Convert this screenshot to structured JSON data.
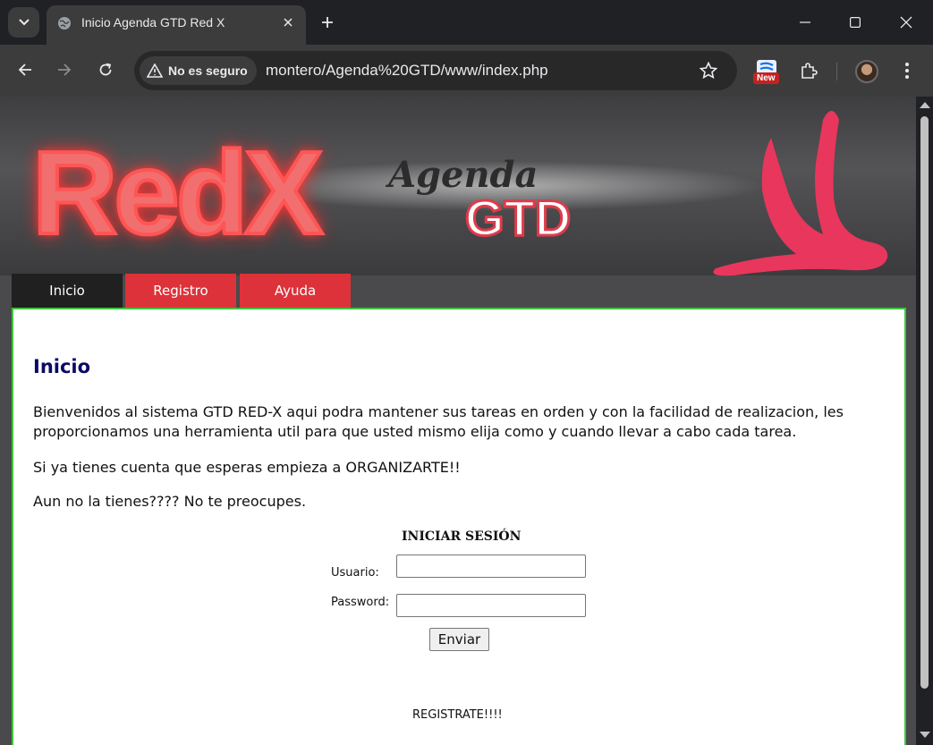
{
  "browser": {
    "tab_title": "Inicio Agenda GTD Red X",
    "security_label": "No es seguro",
    "url": "montero/Agenda%20GTD/www/index.php",
    "extension_badge": "New"
  },
  "banner": {
    "logo_main": "RedX",
    "logo_agenda": "Agenda",
    "logo_gtd": "GTD"
  },
  "nav": {
    "tabs": [
      {
        "label": "Inicio",
        "active": true
      },
      {
        "label": "Registro",
        "active": false
      },
      {
        "label": "Ayuda",
        "active": false
      }
    ]
  },
  "main": {
    "title": "Inicio",
    "paragraphs": [
      "Bienvenidos al sistema GTD RED-X aqui podra mantener sus tareas en orden y con la facilidad de realizacion, les proporcionamos una herramienta util para que usted mismo elija como y cuando llevar a cabo cada tarea.",
      "Si ya tienes cuenta que esperas empieza a ORGANIZARTE!!",
      "Aun no la tienes???? No te preocupes."
    ]
  },
  "login": {
    "title": "INICIAR SESIÓN",
    "user_label": "Usuario:",
    "user_value": "",
    "password_label": "Password:",
    "password_value": "",
    "submit_label": "Enviar",
    "register_link": "REGISTRATE!!!!"
  },
  "colors": {
    "accent_red": "#dd3239",
    "content_border": "#3ec43e",
    "title_navy": "#0a0a66"
  }
}
